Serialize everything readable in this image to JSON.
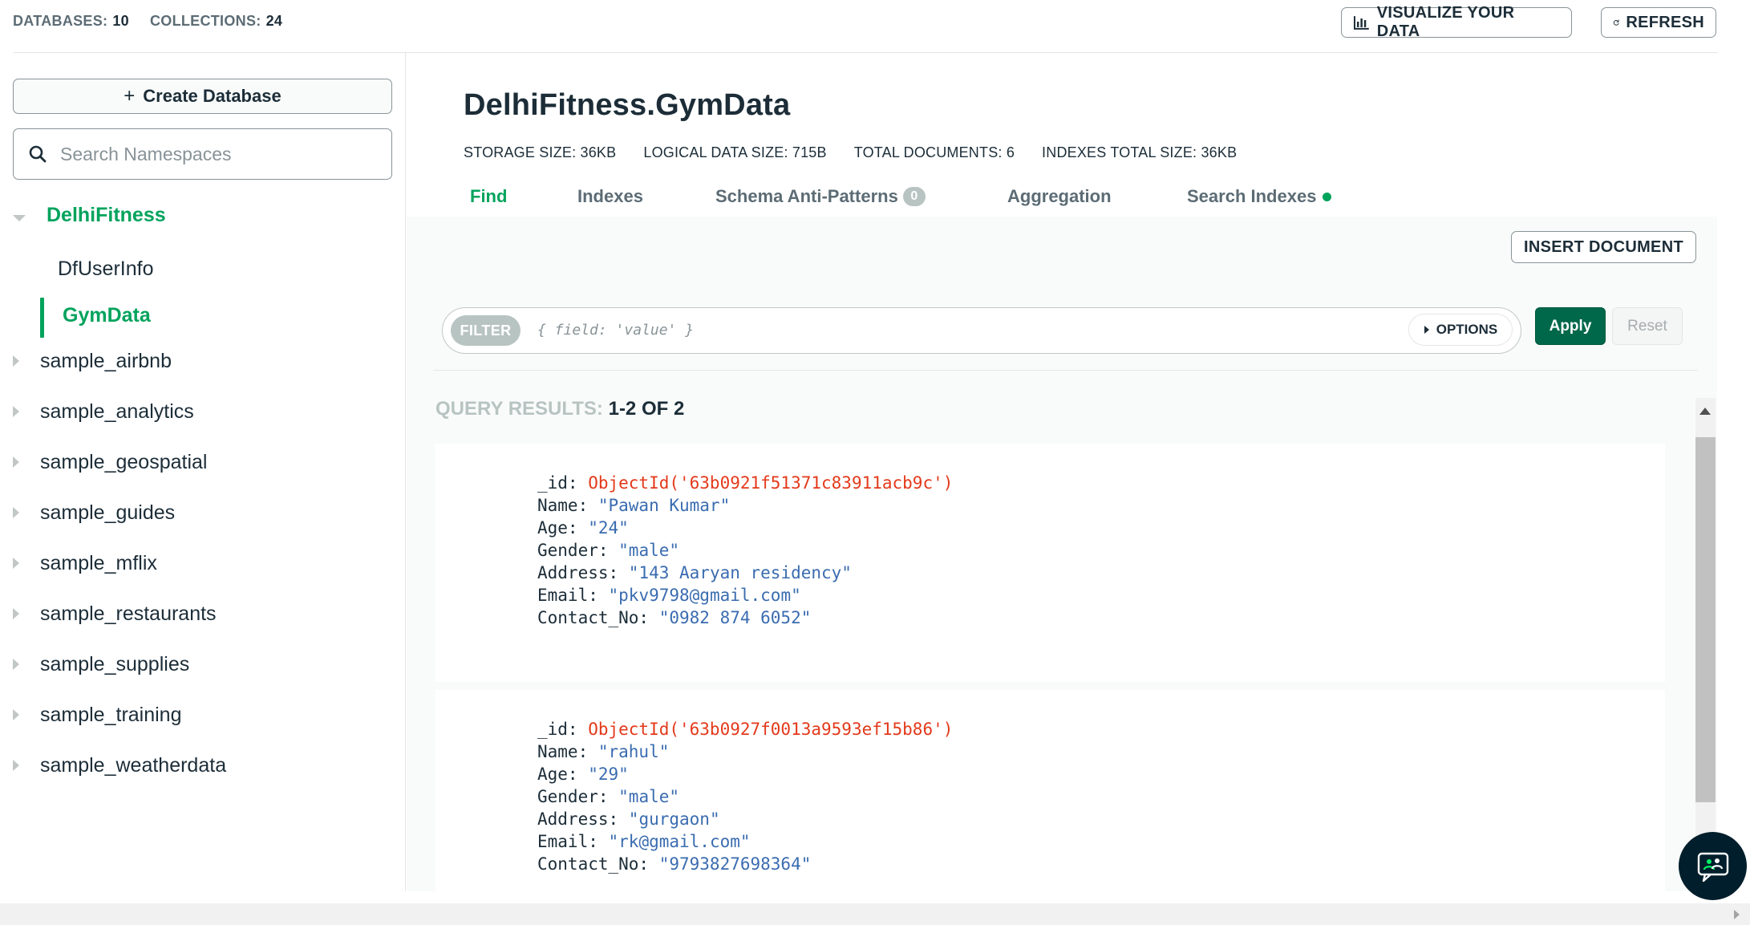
{
  "topbar": {
    "databases_label": "DATABASES:",
    "databases_count": "10",
    "collections_label": "COLLECTIONS:",
    "collections_count": "24",
    "visualize_label": "VISUALIZE YOUR DATA",
    "refresh_label": "REFRESH"
  },
  "sidebar": {
    "create_label": "Create Database",
    "search_placeholder": "Search Namespaces",
    "active_db": "DelhiFitness",
    "collections": [
      "DfUserInfo",
      "GymData"
    ],
    "databases": [
      "sample_airbnb",
      "sample_analytics",
      "sample_geospatial",
      "sample_guides",
      "sample_mflix",
      "sample_restaurants",
      "sample_supplies",
      "sample_training",
      "sample_weatherdata"
    ]
  },
  "main": {
    "namespace": "DelhiFitness.GymData",
    "stats": [
      {
        "label": "STORAGE SIZE:",
        "value": "36KB"
      },
      {
        "label": "LOGICAL DATA SIZE:",
        "value": "715B"
      },
      {
        "label": "TOTAL DOCUMENTS:",
        "value": "6"
      },
      {
        "label": "INDEXES TOTAL SIZE:",
        "value": "36KB"
      }
    ],
    "tabs": [
      {
        "label": "Find",
        "active": true
      },
      {
        "label": "Indexes"
      },
      {
        "label": "Schema Anti-Patterns",
        "badge": "0"
      },
      {
        "label": "Aggregation"
      },
      {
        "label": "Search Indexes",
        "dot": true
      }
    ],
    "insert_label": "INSERT DOCUMENT",
    "filter": {
      "chip": "FILTER",
      "placeholder": "{ field: 'value' }",
      "options_label": "OPTIONS",
      "apply_label": "Apply",
      "reset_label": "Reset"
    },
    "query_results_label": "QUERY RESULTS:",
    "query_results_range": "1-2 OF 2",
    "documents": [
      {
        "_id": "ObjectId('63b0921f51371c83911acb9c')",
        "Name": "\"Pawan Kumar\"",
        "Age": "\"24\"",
        "Gender": "\"male\"",
        "Address": "\"143 Aaryan residency\"",
        "Email": "\"pkv9798@gmail.com\"",
        "Contact_No": "\"0982 874 6052\""
      },
      {
        "_id": "ObjectId('63b0927f0013a9593ef15b86')",
        "Name": "\"rahul\"",
        "Age": "\"29\"",
        "Gender": "\"male\"",
        "Address": "\"gurgaon\"",
        "Email": "\"rk@gmail.com\"",
        "Contact_No": "\"9793827698364\""
      }
    ]
  },
  "colors": {
    "accent_green": "#00a35c",
    "apply_green": "#00684a",
    "object_id_red": "#e3391a",
    "string_blue": "#3a6cb0"
  },
  "icons": {
    "visualize": "bar-chart-icon",
    "refresh": "refresh-icon",
    "search": "search-icon",
    "create": "plus-icon",
    "chat": "chat-assistant-icon"
  }
}
